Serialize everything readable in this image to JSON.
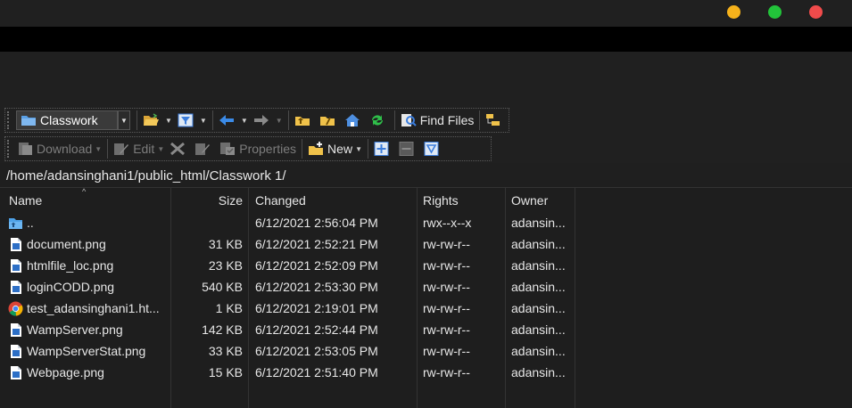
{
  "window": {
    "controls": [
      "minimize",
      "zoom",
      "close"
    ]
  },
  "toolbar1": {
    "location_combo": "Classwork",
    "find_files_label": "Find Files"
  },
  "toolbar2": {
    "download_label": "Download",
    "edit_label": "Edit",
    "properties_label": "Properties",
    "new_label": "New"
  },
  "path": "/home/adansinghani1/public_html/Classwork 1/",
  "columns": {
    "name": "Name",
    "size": "Size",
    "changed": "Changed",
    "rights": "Rights",
    "owner": "Owner"
  },
  "files": [
    {
      "name": "..",
      "size": "",
      "changed": "6/12/2021 2:56:04 PM",
      "rights": "rwx--x--x",
      "owner": "adansin...",
      "icon": "parent-folder-icon"
    },
    {
      "name": "document.png",
      "size": "31 KB",
      "changed": "6/12/2021 2:52:21 PM",
      "rights": "rw-rw-r--",
      "owner": "adansin...",
      "icon": "image-file-icon"
    },
    {
      "name": "htmlfile_loc.png",
      "size": "23 KB",
      "changed": "6/12/2021 2:52:09 PM",
      "rights": "rw-rw-r--",
      "owner": "adansin...",
      "icon": "image-file-icon"
    },
    {
      "name": "loginCODD.png",
      "size": "540 KB",
      "changed": "6/12/2021 2:53:30 PM",
      "rights": "rw-rw-r--",
      "owner": "adansin...",
      "icon": "image-file-icon"
    },
    {
      "name": "test_adansinghani1.ht...",
      "size": "1 KB",
      "changed": "6/12/2021 2:19:01 PM",
      "rights": "rw-rw-r--",
      "owner": "adansin...",
      "icon": "chrome-icon"
    },
    {
      "name": "WampServer.png",
      "size": "142 KB",
      "changed": "6/12/2021 2:52:44 PM",
      "rights": "rw-rw-r--",
      "owner": "adansin...",
      "icon": "image-file-icon"
    },
    {
      "name": "WampServerStat.png",
      "size": "33 KB",
      "changed": "6/12/2021 2:53:05 PM",
      "rights": "rw-rw-r--",
      "owner": "adansin...",
      "icon": "image-file-icon"
    },
    {
      "name": "Webpage.png",
      "size": "15 KB",
      "changed": "6/12/2021 2:51:40 PM",
      "rights": "rw-rw-r--",
      "owner": "adansin...",
      "icon": "image-file-icon"
    }
  ],
  "colors": {
    "background": "#1f1f1f",
    "toolbar_accent": "#3b7ddd",
    "folder": "#f0c24a",
    "refresh": "#2fbf4a"
  }
}
